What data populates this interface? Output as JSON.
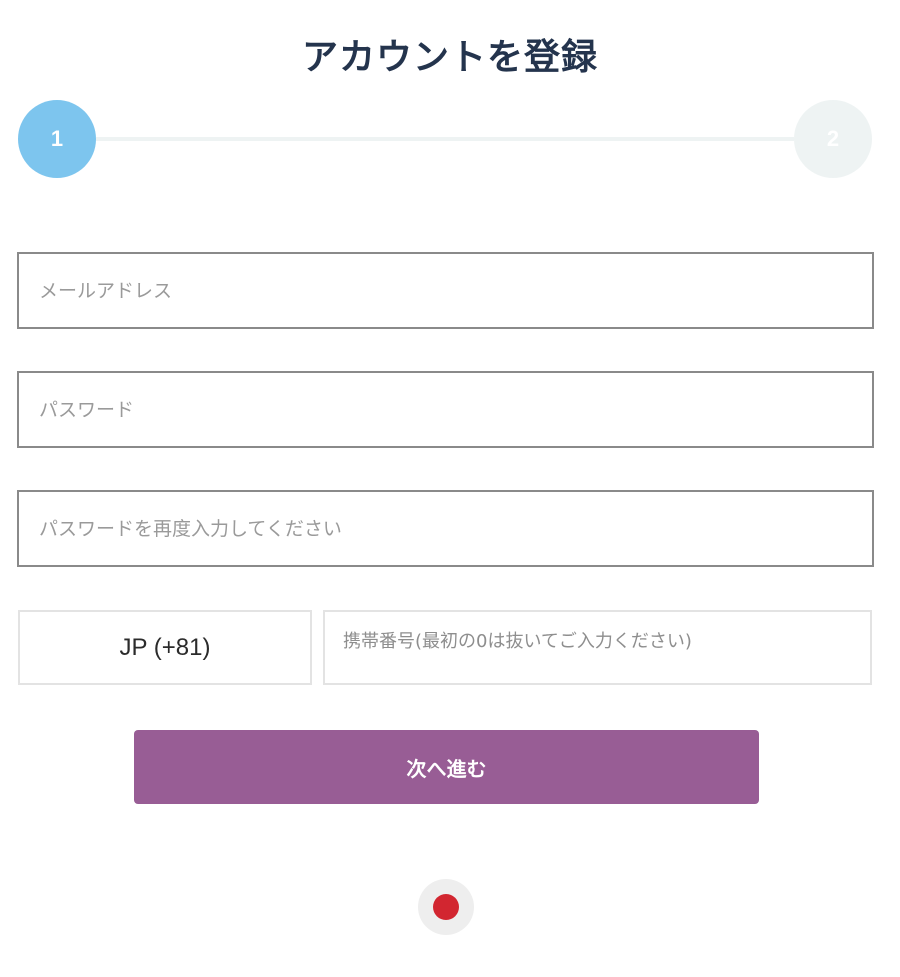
{
  "page": {
    "title": "アカウントを登録"
  },
  "stepper": {
    "steps": [
      {
        "label": "1",
        "active": true
      },
      {
        "label": "2",
        "active": false
      }
    ],
    "colors": {
      "active": "#7dc5ee",
      "inactive": "#eef3f3"
    }
  },
  "form": {
    "email_placeholder": "メールアドレス",
    "password_placeholder": "パスワード",
    "password_confirm_placeholder": "パスワードを再度入力してください",
    "country_code_selected": "JP (+81)",
    "phone_placeholder": "携帯番号(最初の0は抜いてご入力ください)",
    "next_button_label": "次へ進む"
  },
  "footer": {
    "language_icon": "japan-flag-icon"
  },
  "colors": {
    "title": "#24344d",
    "button": "#985d95",
    "flag": "#d22630"
  }
}
